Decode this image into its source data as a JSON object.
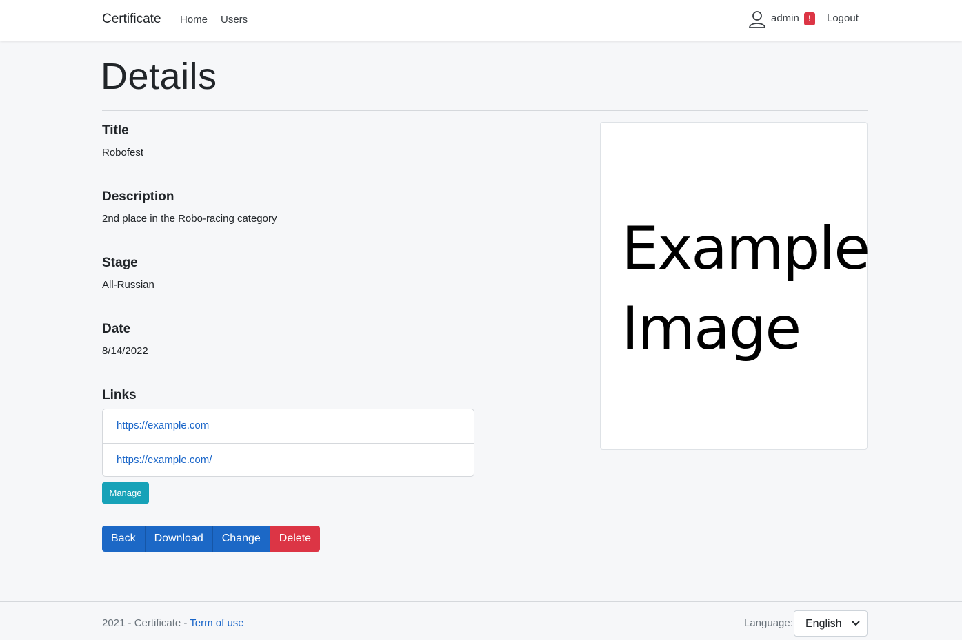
{
  "navbar": {
    "brand": "Certificate",
    "links": [
      "Home",
      "Users"
    ],
    "user": "admin",
    "badge": "!",
    "logout": "Logout"
  },
  "page": {
    "title": "Details"
  },
  "fields": {
    "title_label": "Title",
    "title_value": "Robofest",
    "description_label": "Description",
    "description_value": "2nd place in the Robo-racing category",
    "stage_label": "Stage",
    "stage_value": "All-Russian",
    "date_label": "Date",
    "date_value": "8/14/2022",
    "links_label": "Links"
  },
  "links": [
    "https://example.com",
    "https://example.com/"
  ],
  "buttons": {
    "manage": "Manage",
    "back": "Back",
    "download": "Download",
    "change": "Change",
    "delete": "Delete"
  },
  "image": {
    "line1": "Example",
    "line2": "Image"
  },
  "footer": {
    "copyright": "2021 - Certificate - ",
    "terms": "Term of use",
    "language_label": "Language:",
    "language_value": "English"
  },
  "colors": {
    "primary": "#1c68c6",
    "danger": "#dc3545",
    "info": "#17a2b8",
    "background": "#f6f7f9"
  }
}
